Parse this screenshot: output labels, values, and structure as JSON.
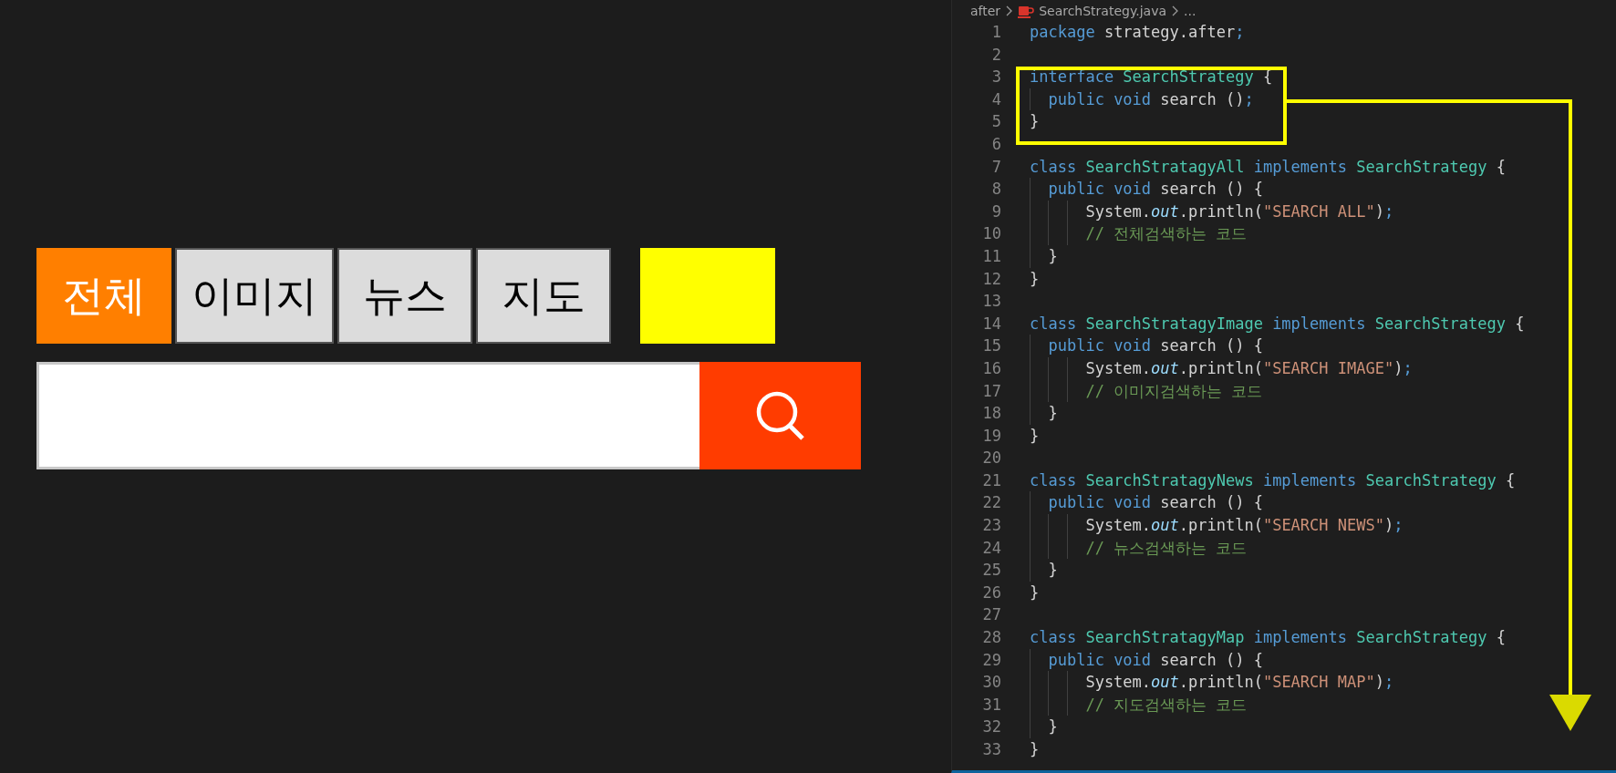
{
  "tabs": [
    {
      "label": "전체",
      "selected": true
    },
    {
      "label": "이미지",
      "selected": false
    },
    {
      "label": "뉴스",
      "selected": false
    },
    {
      "label": "지도",
      "selected": false
    }
  ],
  "breadcrumb": [
    "after",
    "SearchStrategy.java",
    "..."
  ],
  "code": [
    {
      "number": "1",
      "tokens": [
        {
          "kind": "keyword",
          "text": "package"
        },
        {
          "kind": "plain",
          "text": " strategy.after"
        },
        {
          "kind": "punct",
          "text": ";"
        }
      ]
    },
    {
      "number": "2"
    },
    {
      "number": "3",
      "tokens": [
        {
          "kind": "keyword",
          "text": "interface"
        },
        {
          "kind": "type",
          "text": " SearchStrategy"
        },
        {
          "kind": "plain",
          "text": " {"
        }
      ]
    },
    {
      "number": "4",
      "tokens": [
        {
          "kind": "keyword",
          "text": "  public"
        },
        {
          "kind": "keyword",
          "text": " void"
        },
        {
          "kind": "plain",
          "text": " search ()"
        },
        {
          "kind": "punct",
          "text": ";"
        }
      ]
    },
    {
      "number": "5",
      "tokens": [
        {
          "kind": "plain",
          "text": "}"
        }
      ]
    },
    {
      "number": "6"
    },
    {
      "number": "7",
      "tokens": [
        {
          "kind": "keyword",
          "text": "class"
        },
        {
          "kind": "type",
          "text": " SearchStratagyAll"
        },
        {
          "kind": "keyword",
          "text": " implements"
        },
        {
          "kind": "type",
          "text": " SearchStrategy"
        },
        {
          "kind": "plain",
          "text": " {"
        }
      ]
    },
    {
      "number": "8",
      "tokens": [
        {
          "kind": "keyword",
          "text": "  public"
        },
        {
          "kind": "keyword",
          "text": " void"
        },
        {
          "kind": "plain",
          "text": " search () {"
        }
      ]
    },
    {
      "number": "9",
      "tokens": [
        {
          "kind": "plain",
          "text": "      System."
        },
        {
          "kind": "field",
          "text": "out"
        },
        {
          "kind": "plain",
          "text": ".println("
        },
        {
          "kind": "string",
          "text": "\"SEARCH ALL\""
        },
        {
          "kind": "plain",
          "text": ")"
        },
        {
          "kind": "punct",
          "text": ";"
        }
      ]
    },
    {
      "number": "10",
      "tokens": [
        {
          "kind": "comment",
          "text": "      // 전체검색하는 코드"
        }
      ]
    },
    {
      "number": "11",
      "tokens": [
        {
          "kind": "plain",
          "text": "  }"
        }
      ]
    },
    {
      "number": "12",
      "tokens": [
        {
          "kind": "plain",
          "text": "}"
        }
      ]
    },
    {
      "number": "13"
    },
    {
      "number": "14",
      "tokens": [
        {
          "kind": "keyword",
          "text": "class"
        },
        {
          "kind": "type",
          "text": " SearchStratagyImage"
        },
        {
          "kind": "keyword",
          "text": " implements"
        },
        {
          "kind": "type",
          "text": " SearchStrategy"
        },
        {
          "kind": "plain",
          "text": " {"
        }
      ]
    },
    {
      "number": "15",
      "tokens": [
        {
          "kind": "keyword",
          "text": "  public"
        },
        {
          "kind": "keyword",
          "text": " void"
        },
        {
          "kind": "plain",
          "text": " search () {"
        }
      ]
    },
    {
      "number": "16",
      "tokens": [
        {
          "kind": "plain",
          "text": "      System."
        },
        {
          "kind": "field",
          "text": "out"
        },
        {
          "kind": "plain",
          "text": ".println("
        },
        {
          "kind": "string",
          "text": "\"SEARCH IMAGE\""
        },
        {
          "kind": "plain",
          "text": ")"
        },
        {
          "kind": "punct",
          "text": ";"
        }
      ]
    },
    {
      "number": "17",
      "tokens": [
        {
          "kind": "comment",
          "text": "      // 이미지검색하는 코드"
        }
      ]
    },
    {
      "number": "18",
      "tokens": [
        {
          "kind": "plain",
          "text": "  }"
        }
      ]
    },
    {
      "number": "19",
      "tokens": [
        {
          "kind": "plain",
          "text": "}"
        }
      ]
    },
    {
      "number": "20"
    },
    {
      "number": "21",
      "tokens": [
        {
          "kind": "keyword",
          "text": "class"
        },
        {
          "kind": "type",
          "text": " SearchStratagyNews"
        },
        {
          "kind": "keyword",
          "text": " implements"
        },
        {
          "kind": "type",
          "text": " SearchStrategy"
        },
        {
          "kind": "plain",
          "text": " {"
        }
      ]
    },
    {
      "number": "22",
      "tokens": [
        {
          "kind": "keyword",
          "text": "  public"
        },
        {
          "kind": "keyword",
          "text": " void"
        },
        {
          "kind": "plain",
          "text": " search () {"
        }
      ]
    },
    {
      "number": "23",
      "tokens": [
        {
          "kind": "plain",
          "text": "      System."
        },
        {
          "kind": "field",
          "text": "out"
        },
        {
          "kind": "plain",
          "text": ".println("
        },
        {
          "kind": "string",
          "text": "\"SEARCH NEWS\""
        },
        {
          "kind": "plain",
          "text": ")"
        },
        {
          "kind": "punct",
          "text": ";"
        }
      ]
    },
    {
      "number": "24",
      "tokens": [
        {
          "kind": "comment",
          "text": "      // 뉴스검색하는 코드"
        }
      ]
    },
    {
      "number": "25",
      "tokens": [
        {
          "kind": "plain",
          "text": "  }"
        }
      ]
    },
    {
      "number": "26",
      "tokens": [
        {
          "kind": "plain",
          "text": "}"
        }
      ]
    },
    {
      "number": "27"
    },
    {
      "number": "28",
      "tokens": [
        {
          "kind": "keyword",
          "text": "class"
        },
        {
          "kind": "type",
          "text": " SearchStratagyMap"
        },
        {
          "kind": "keyword",
          "text": " implements"
        },
        {
          "kind": "type",
          "text": " SearchStrategy"
        },
        {
          "kind": "plain",
          "text": " {"
        }
      ]
    },
    {
      "number": "29",
      "tokens": [
        {
          "kind": "keyword",
          "text": "  public"
        },
        {
          "kind": "keyword",
          "text": " void"
        },
        {
          "kind": "plain",
          "text": " search () {"
        }
      ]
    },
    {
      "number": "30",
      "tokens": [
        {
          "kind": "plain",
          "text": "      System."
        },
        {
          "kind": "field",
          "text": "out"
        },
        {
          "kind": "plain",
          "text": ".println("
        },
        {
          "kind": "string",
          "text": "\"SEARCH MAP\""
        },
        {
          "kind": "plain",
          "text": ")"
        },
        {
          "kind": "punct",
          "text": ";"
        }
      ]
    },
    {
      "number": "31",
      "tokens": [
        {
          "kind": "comment",
          "text": "      // 지도검색하는 코드"
        }
      ]
    },
    {
      "number": "32",
      "tokens": [
        {
          "kind": "plain",
          "text": "  }"
        }
      ]
    },
    {
      "number": "33",
      "tokens": [
        {
          "kind": "plain",
          "text": "}"
        }
      ]
    }
  ]
}
